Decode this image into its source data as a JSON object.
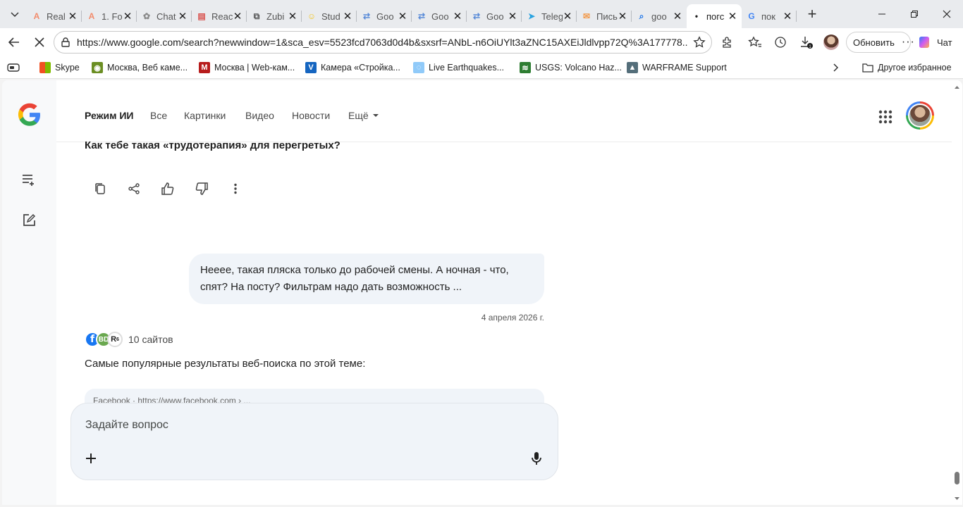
{
  "browser": {
    "tabs": [
      {
        "title": "Real",
        "favicon": "A",
        "color": "#f28b6b",
        "active": false
      },
      {
        "title": "1. Fo",
        "favicon": "A",
        "color": "#f28b6b",
        "active": false
      },
      {
        "title": "Chat",
        "favicon": "openai-icon",
        "color": "#888888",
        "active": false
      },
      {
        "title": "Reac",
        "favicon": "slides-icon",
        "color": "#d9534f",
        "active": false
      },
      {
        "title": "Zubi",
        "favicon": "zubi-icon",
        "color": "#555555",
        "active": false
      },
      {
        "title": "Stud",
        "favicon": "face-icon",
        "color": "#f3c623",
        "active": false
      },
      {
        "title": "Goo",
        "favicon": "translate-icon",
        "color": "#5a8bd8",
        "active": false
      },
      {
        "title": "Goo",
        "favicon": "translate-icon",
        "color": "#5a8bd8",
        "active": false
      },
      {
        "title": "Goo",
        "favicon": "translate-icon",
        "color": "#5a8bd8",
        "active": false
      },
      {
        "title": "Teleg",
        "favicon": "telegram-icon",
        "color": "#2aa3e0",
        "active": false
      },
      {
        "title": "Пись",
        "favicon": "mail-icon",
        "color": "#f2994a",
        "active": false
      },
      {
        "title": "goo",
        "favicon": "search-icon",
        "color": "#1a73e8",
        "active": false
      },
      {
        "title": "погс",
        "favicon": "dot-icon",
        "color": "#1f1f1f",
        "active": true
      },
      {
        "title": "пок",
        "favicon": "google-icon",
        "color": "#4285f4",
        "active": false
      }
    ],
    "url": "https://www.google.com/search?newwindow=1&sca_esv=5523fcd7063d0d4b&sxsrf=ANbL-n6OiUYlt3aZNC15AXEiJldlvpp72Q%3A177778...",
    "update_label": "Обновить",
    "chat_label": "Чат",
    "bookmarks": [
      {
        "label": "Skype",
        "icon": "windows-icon"
      },
      {
        "label": "Москва, Веб каме...",
        "icon": "camera-icon"
      },
      {
        "label": "Москва | Web-кам...",
        "icon": "m-icon"
      },
      {
        "label": "Камера «Стройка...",
        "icon": "v-icon"
      },
      {
        "label": "Live Earthquakes...",
        "icon": "earth-icon"
      },
      {
        "label": "USGS: Volcano Haz...",
        "icon": "usgs-icon"
      },
      {
        "label": "WARFRAME Support",
        "icon": "warframe-icon"
      }
    ],
    "other_bookmarks": "Другое избранное"
  },
  "nav": {
    "items": [
      "Режим ИИ",
      "Все",
      "Картинки",
      "Видео",
      "Новости",
      "Ещё"
    ]
  },
  "conversation": {
    "answer_tail": "Как тебе такая «трудотерапия» для перегретых?",
    "user_message": "Нееее, такая пляска только до рабочей смены. А ночная - что, спят? На посту? Фильтрам надо дать возможность ...",
    "date": "4 апреля 2026 г.",
    "source_badge": "6",
    "sources_count": "10 сайтов",
    "popular_text": "Самые популярные результаты веб-поиска по этой теме:",
    "card_peek": "Facebook · https://www.facebook.com › ..."
  },
  "composer": {
    "placeholder": "Задайте вопрос"
  },
  "colors": {
    "accent_blue": "#4285f4",
    "google_red": "#ea4335",
    "google_yellow": "#fbbc04",
    "google_green": "#34a853"
  }
}
